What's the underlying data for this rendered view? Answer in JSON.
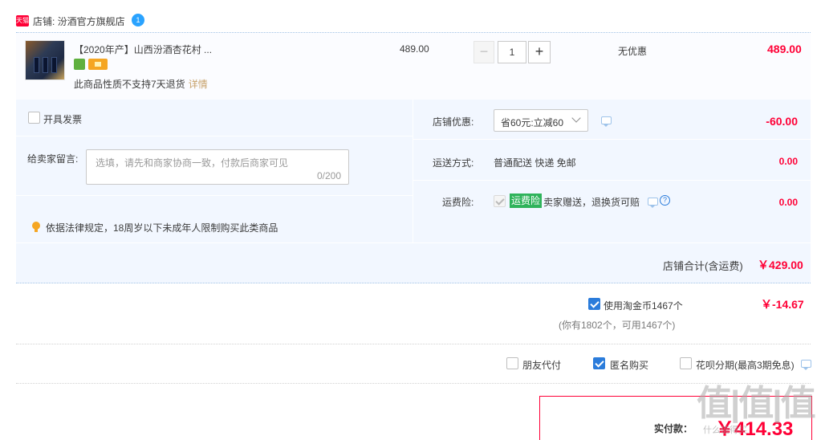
{
  "shop": {
    "badge_text": "天猫",
    "label": "店铺: 汾酒官方旗舰店",
    "chat_badge": "1"
  },
  "item": {
    "title": "【2020年产】山西汾酒杏花村 ...",
    "no_return_text": "此商品性质不支持7天退货",
    "detail_link": "详情",
    "unit_price": "489.00",
    "qty_minus": "−",
    "quantity": "1",
    "qty_plus": "+",
    "discount_text": "无优惠",
    "line_total": "489.00"
  },
  "options": {
    "invoice_label": "开具发票",
    "message_label": "给卖家留言:",
    "message_placeholder": "选填，请先和商家协商一致，付款后商家可见",
    "message_count": "0/200",
    "legal_notice": "依据法律规定，18周岁以下未成年人限制购买此类商品",
    "shop_discount_label": "店铺优惠:",
    "shop_discount_selected": "省60元:立减60",
    "shop_discount_amount": "-60.00",
    "shipping_label": "运送方式:",
    "shipping_value": "普通配送 快递 免邮",
    "shipping_amount": "0.00",
    "insurance_label": "运费险:",
    "insurance_badge": "运费险",
    "insurance_text": "卖家赠送，退换货可赔",
    "insurance_help": "?",
    "insurance_amount": "0.00",
    "store_total_label": "店铺合计(含运费)",
    "store_total_value": "￥429.00"
  },
  "coins": {
    "label": "使用淘金币1467个",
    "value": "￥-14.67",
    "note": "(你有1802个，可用1467个)"
  },
  "pay_options": {
    "friend_pay": "朋友代付",
    "anonymous": "匿名购买",
    "huabei": "花呗分期(最高3期免息)"
  },
  "final": {
    "label": "实付款：",
    "value": "￥414.33"
  },
  "watermark": {
    "text": "值|值|值",
    "sub": "什么值得买"
  },
  "colors": {
    "price_red": "#ff0036",
    "link_gold": "#c7a16a",
    "checkbox_blue": "#2b7cdb",
    "insurance_green": "#2fb35b",
    "panel_bg": "#f2f7ff"
  }
}
